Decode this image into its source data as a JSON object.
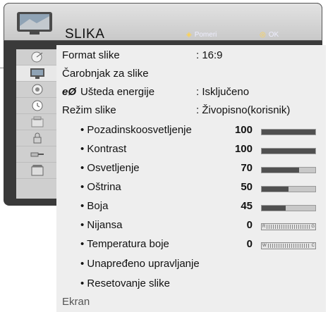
{
  "header": {
    "title": "SLIKA",
    "hint_move": "Pomeri",
    "hint_ok": "OK"
  },
  "sidebar": {
    "items": [
      {
        "icon": "satellite-dish-icon"
      },
      {
        "icon": "tv-picture-icon",
        "active": true
      },
      {
        "icon": "audio-icon"
      },
      {
        "icon": "clock-icon"
      },
      {
        "icon": "lock-settings-icon"
      },
      {
        "icon": "padlock-icon"
      },
      {
        "icon": "input-cable-icon"
      },
      {
        "icon": "media-icon"
      }
    ]
  },
  "menu": {
    "format": {
      "label": "Format slike",
      "value": ": 16:9"
    },
    "wizard": {
      "label": "Čarobnjak za slike"
    },
    "energy": {
      "label": "Ušteda energije",
      "value": ": Isključeno"
    },
    "mode": {
      "label": "Režim slike",
      "value": ": Živopisno(korisnik)"
    },
    "items": [
      {
        "label": "• Pozadinskoosvetljenje",
        "value": "100",
        "level": 1.0
      },
      {
        "label": "• Kontrast",
        "value": "100",
        "level": 1.0
      },
      {
        "label": "• Osvetljenje",
        "value": "70",
        "level": 0.7
      },
      {
        "label": "• Oštrina",
        "value": "50",
        "level": 0.5
      },
      {
        "label": "• Boja",
        "value": "45",
        "level": 0.45
      }
    ],
    "tint": {
      "label": "• Nijansa",
      "value": "0",
      "left": "R",
      "right": "G"
    },
    "temp": {
      "label": "• Temperatura boje",
      "value": "0",
      "left": "W",
      "right": "C"
    },
    "advanced": {
      "label": "• Unapređeno upravljanje"
    },
    "reset": {
      "label": "• Resetovanje slike"
    },
    "screen": {
      "label": "Ekran"
    }
  },
  "colors": {
    "hint_glyph": "#ffd24d",
    "bar_fill": "#505050",
    "panel": "#eeeeee"
  }
}
